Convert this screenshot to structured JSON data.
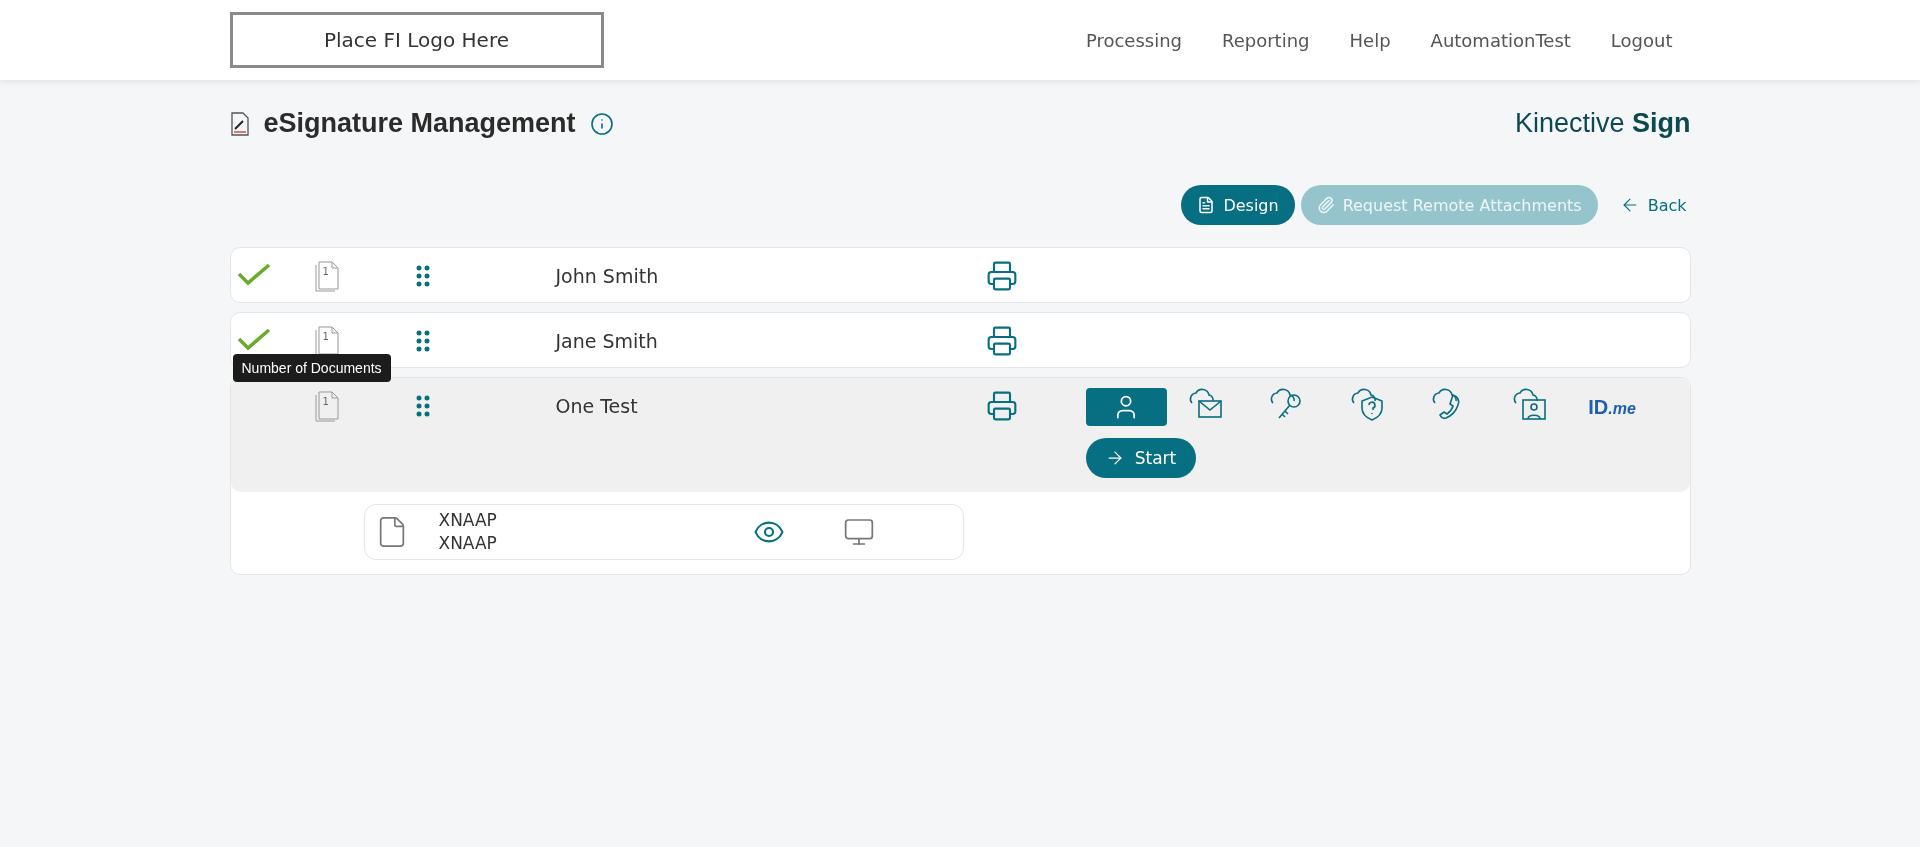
{
  "header": {
    "logo": "Place FI Logo Here",
    "nav": [
      {
        "label": "Processing"
      },
      {
        "label": "Reporting"
      },
      {
        "label": "Help"
      },
      {
        "label": "AutomationTest"
      },
      {
        "label": "Logout"
      }
    ]
  },
  "page": {
    "title": "eSignature Management",
    "brand_light": "Kinective",
    "brand_bold": "Sign"
  },
  "actions": [
    {
      "label": "Design",
      "kind": "design",
      "disabled": false
    },
    {
      "label": "Request Remote Attachments",
      "kind": "attach",
      "disabled": true
    },
    {
      "label": "Back",
      "kind": "back",
      "disabled": false
    }
  ],
  "signers": [
    {
      "name": "John Smith",
      "signed": true,
      "doc_count": "1",
      "expanded": false
    },
    {
      "name": "Jane Smith",
      "signed": true,
      "doc_count": "1",
      "expanded": false
    },
    {
      "name": "One Test",
      "signed": false,
      "doc_count": "1",
      "expanded": true,
      "tooltip": "Number of Documents"
    }
  ],
  "auth_methods": [
    {
      "kind": "person",
      "selected": true
    },
    {
      "kind": "email",
      "selected": false
    },
    {
      "kind": "key",
      "selected": false
    },
    {
      "kind": "question",
      "selected": false
    },
    {
      "kind": "phone",
      "selected": false
    },
    {
      "kind": "video",
      "selected": false
    },
    {
      "kind": "idme",
      "label": "ID",
      "label_small": ".me",
      "selected": false
    }
  ],
  "start_button": "Start",
  "documents": [
    {
      "title": "XNAAP",
      "subtitle": "XNAAP"
    }
  ]
}
